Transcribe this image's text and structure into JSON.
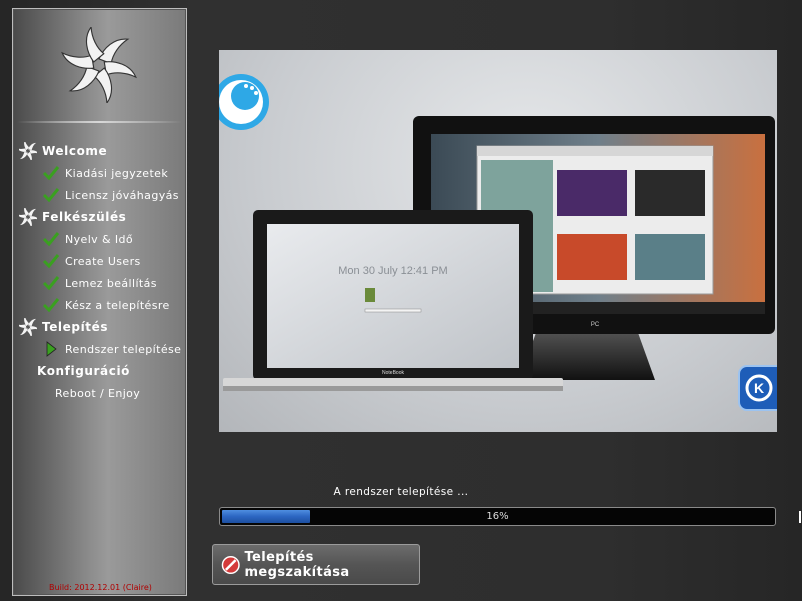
{
  "sidebar": {
    "steps": [
      {
        "label": "Welcome",
        "kind": "section",
        "icon": "logo-icon"
      },
      {
        "label": "Kiadási jegyzetek",
        "kind": "done",
        "icon": "checkmark-icon"
      },
      {
        "label": "Licensz jóváhagyás",
        "kind": "done",
        "icon": "checkmark-icon"
      },
      {
        "label": "Felkészülés",
        "kind": "section",
        "icon": "logo-icon"
      },
      {
        "label": "Nyelv & Idő",
        "kind": "done",
        "icon": "checkmark-icon"
      },
      {
        "label": "Create Users",
        "kind": "done",
        "icon": "checkmark-icon"
      },
      {
        "label": "Lemez beállítás",
        "kind": "done",
        "icon": "checkmark-icon"
      },
      {
        "label": "Kész a telepítésre",
        "kind": "done",
        "icon": "checkmark-icon"
      },
      {
        "label": "Telepítés",
        "kind": "section",
        "icon": "logo-icon"
      },
      {
        "label": "Rendszer telepítése",
        "kind": "current",
        "icon": "play-arrow-icon"
      },
      {
        "label": "Konfiguráció",
        "kind": "section",
        "icon": "none"
      },
      {
        "label": "Reboot / Enjoy",
        "kind": "pending",
        "icon": "none"
      }
    ],
    "build": "Build: 2012.12.01 (Claire)"
  },
  "preview": {
    "laptop_clock": "Mon 30 July 12:41 PM",
    "laptop_label": "NoteBook",
    "monitor_label": "PC"
  },
  "status": {
    "text": "A rendszer telepítése ...",
    "progress_label": "16%",
    "progress_fraction": 0.16
  },
  "buttons": {
    "cancel_label": "Telepítés megszakítása"
  },
  "colors": {
    "accent": "#2c66c2",
    "check": "#3aa020",
    "build_text": "#b00000"
  }
}
